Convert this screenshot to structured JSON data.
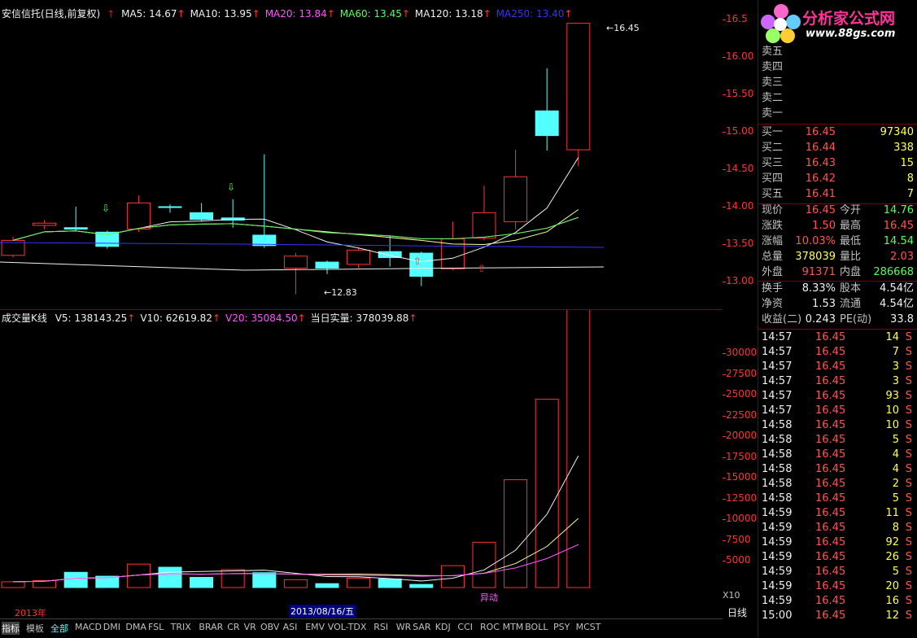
{
  "price_legend": {
    "title": "安信信托(日线,前复权)",
    "items": [
      {
        "label": "MA5: 14.67",
        "color": "#f0f0f0"
      },
      {
        "label": "MA10: 13.95",
        "color": "#f0f0f0"
      },
      {
        "label": "MA20: 13.84",
        "color": "#ff54ff"
      },
      {
        "label": "MA60: 13.45",
        "color": "#54ff54"
      },
      {
        "label": "MA120: 13.18",
        "color": "#f0f0f0"
      },
      {
        "label": "MA250: 13.40",
        "color": "#3333ff"
      }
    ]
  },
  "volume_legend": {
    "title": "成交量K线",
    "items": [
      {
        "label": "V5: 138143.25",
        "color": "#f0f0f0"
      },
      {
        "label": "V10: 62619.82",
        "color": "#f0f0f0"
      },
      {
        "label": "V20: 35084.50",
        "color": "#ff54ff"
      },
      {
        "label": "当日实量: 378039.88",
        "color": "#f0f0f0"
      }
    ]
  },
  "price_axis": [
    "16.5",
    "16.00",
    "15.50",
    "15.00",
    "14.50",
    "14.00",
    "13.50",
    "13.00"
  ],
  "volume_axis": [
    "30000",
    "27500",
    "25000",
    "22500",
    "20000",
    "17500",
    "15000",
    "12500",
    "10000",
    "7500",
    "5000"
  ],
  "volume_axis_unit": "X10",
  "chart_annotations": {
    "high_label": "16.45",
    "low_label": "12.83",
    "year_label": "2013年",
    "date_label": "2013/08/16/五",
    "abnormal_label": "异动"
  },
  "logo": {
    "name": "分析家公式网",
    "url_text": "www.88gs.com"
  },
  "order_book": {
    "sell": [
      {
        "label": "卖五",
        "price": "",
        "vol": ""
      },
      {
        "label": "卖四",
        "price": "",
        "vol": ""
      },
      {
        "label": "卖三",
        "price": "",
        "vol": ""
      },
      {
        "label": "卖二",
        "price": "",
        "vol": ""
      },
      {
        "label": "卖一",
        "price": "",
        "vol": ""
      }
    ],
    "buy": [
      {
        "label": "买一",
        "price": "16.45",
        "vol": "97340"
      },
      {
        "label": "买二",
        "price": "16.44",
        "vol": "338"
      },
      {
        "label": "买三",
        "price": "16.43",
        "vol": "15"
      },
      {
        "label": "买四",
        "price": "16.42",
        "vol": "8"
      },
      {
        "label": "买五",
        "price": "16.41",
        "vol": "7"
      }
    ]
  },
  "quote": [
    {
      "l1": "现价",
      "v1": "16.45",
      "c1": "red",
      "l2": "今开",
      "v2": "14.76",
      "c2": "green"
    },
    {
      "l1": "涨跌",
      "v1": "1.50",
      "c1": "red",
      "l2": "最高",
      "v2": "16.45",
      "c2": "red"
    },
    {
      "l1": "涨幅",
      "v1": "10.03%",
      "c1": "red",
      "l2": "最低",
      "v2": "14.54",
      "c2": "green"
    },
    {
      "l1": "总量",
      "v1": "378039",
      "c1": "yellow",
      "l2": "量比",
      "v2": "2.03",
      "c2": "red"
    },
    {
      "l1": "外盘",
      "v1": "91371",
      "c1": "red",
      "l2": "内盘",
      "v2": "286668",
      "c2": "green"
    }
  ],
  "fundamentals": [
    {
      "l1": "换手",
      "v1": "8.33%",
      "l2": "股本",
      "v2": "4.54亿"
    },
    {
      "l1": "净资",
      "v1": "1.53",
      "l2": "流通",
      "v2": "4.54亿"
    },
    {
      "l1": "收益(二)",
      "v1": "0.243",
      "l2": "PE(动)",
      "v2": "33.8"
    }
  ],
  "ticks": [
    {
      "time": "14:57",
      "price": "16.45",
      "qty": "14",
      "side": "S"
    },
    {
      "time": "14:57",
      "price": "16.45",
      "qty": "7",
      "side": "S"
    },
    {
      "time": "14:57",
      "price": "16.45",
      "qty": "3",
      "side": "S"
    },
    {
      "time": "14:57",
      "price": "16.45",
      "qty": "3",
      "side": "S"
    },
    {
      "time": "14:57",
      "price": "16.45",
      "qty": "93",
      "side": "S"
    },
    {
      "time": "14:57",
      "price": "16.45",
      "qty": "10",
      "side": "S"
    },
    {
      "time": "14:58",
      "price": "16.45",
      "qty": "10",
      "side": "S"
    },
    {
      "time": "14:58",
      "price": "16.45",
      "qty": "5",
      "side": "S"
    },
    {
      "time": "14:58",
      "price": "16.45",
      "qty": "4",
      "side": "S"
    },
    {
      "time": "14:58",
      "price": "16.45",
      "qty": "4",
      "side": "S"
    },
    {
      "time": "14:58",
      "price": "16.45",
      "qty": "2",
      "side": "S"
    },
    {
      "time": "14:58",
      "price": "16.45",
      "qty": "5",
      "side": "S"
    },
    {
      "time": "14:59",
      "price": "16.45",
      "qty": "11",
      "side": "S"
    },
    {
      "time": "14:59",
      "price": "16.45",
      "qty": "8",
      "side": "S"
    },
    {
      "time": "14:59",
      "price": "16.45",
      "qty": "92",
      "side": "S"
    },
    {
      "time": "14:59",
      "price": "16.45",
      "qty": "26",
      "side": "S"
    },
    {
      "time": "14:59",
      "price": "16.45",
      "qty": "5",
      "side": "S"
    },
    {
      "time": "14:59",
      "price": "16.45",
      "qty": "20",
      "side": "S"
    },
    {
      "time": "14:59",
      "price": "16.45",
      "qty": "16",
      "side": "S"
    },
    {
      "time": "15:00",
      "price": "16.45",
      "qty": "12",
      "side": "S"
    }
  ],
  "bottom_tabs": [
    "指标",
    "模板",
    "全部",
    "MACD",
    "DMI",
    "DMA",
    "FSL",
    "TRIX",
    "BRAR",
    "CR",
    "VR",
    "OBV",
    "ASI",
    "EMV",
    "VOL-TDX",
    "RSI",
    "WR",
    "SAR",
    "KDJ",
    "CCI",
    "ROC",
    "MTM",
    "BOLL",
    "PSY",
    "MCST"
  ],
  "period_label": "日线",
  "colors": {
    "up": "#ff3333",
    "down": "#54ffff",
    "axis": "#ff3333",
    "frame": "#800000"
  },
  "chart_data": {
    "type": "candlestick",
    "candles": [
      {
        "o": 13.35,
        "c": 13.55,
        "h": 13.6,
        "l": 13.32
      },
      {
        "o": 13.75,
        "c": 13.78,
        "h": 13.82,
        "l": 13.7
      },
      {
        "o": 13.72,
        "c": 13.7,
        "h": 14.0,
        "l": 13.68
      },
      {
        "o": 13.66,
        "c": 13.47,
        "h": 13.68,
        "l": 13.44
      },
      {
        "o": 13.7,
        "c": 14.05,
        "h": 14.15,
        "l": 13.66
      },
      {
        "o": 14.0,
        "c": 13.99,
        "h": 14.03,
        "l": 13.92
      },
      {
        "o": 13.92,
        "c": 13.83,
        "h": 14.05,
        "l": 13.8
      },
      {
        "o": 13.85,
        "c": 13.82,
        "h": 14.1,
        "l": 13.72
      },
      {
        "o": 13.62,
        "c": 13.48,
        "h": 14.7,
        "l": 13.45
      },
      {
        "o": 13.18,
        "c": 13.34,
        "h": 13.38,
        "l": 12.83
      },
      {
        "o": 13.26,
        "c": 13.18,
        "h": 13.28,
        "l": 13.1
      },
      {
        "o": 13.23,
        "c": 13.42,
        "h": 13.45,
        "l": 13.18
      },
      {
        "o": 13.4,
        "c": 13.32,
        "h": 13.62,
        "l": 13.2
      },
      {
        "o": 13.38,
        "c": 13.07,
        "h": 13.4,
        "l": 12.94
      },
      {
        "o": 13.17,
        "c": 13.57,
        "h": 13.8,
        "l": 13.15
      },
      {
        "o": 13.58,
        "c": 13.92,
        "h": 14.28,
        "l": 13.55
      },
      {
        "o": 13.8,
        "c": 14.4,
        "h": 14.76,
        "l": 13.7
      },
      {
        "o": 15.28,
        "c": 14.95,
        "h": 15.85,
        "l": 14.75
      },
      {
        "o": 14.76,
        "c": 16.45,
        "h": 16.45,
        "l": 14.54
      }
    ],
    "volumes": [
      {
        "v": 740,
        "up": true
      },
      {
        "v": 880,
        "up": true
      },
      {
        "v": 1950,
        "up": false
      },
      {
        "v": 1450,
        "up": false
      },
      {
        "v": 3000,
        "up": true
      },
      {
        "v": 2600,
        "up": false
      },
      {
        "v": 1300,
        "up": false
      },
      {
        "v": 2300,
        "up": true
      },
      {
        "v": 1900,
        "up": false
      },
      {
        "v": 1000,
        "up": true
      },
      {
        "v": 500,
        "up": false
      },
      {
        "v": 1200,
        "up": true
      },
      {
        "v": 1100,
        "up": false
      },
      {
        "v": 400,
        "up": false
      },
      {
        "v": 2800,
        "up": true
      },
      {
        "v": 5800,
        "up": true
      },
      {
        "v": 13800,
        "up": true
      },
      {
        "v": 24100,
        "up": true
      },
      {
        "v": 37800,
        "up": true
      }
    ],
    "price_range": [
      12.8,
      16.6
    ],
    "volume_range": [
      0,
      36000
    ]
  }
}
